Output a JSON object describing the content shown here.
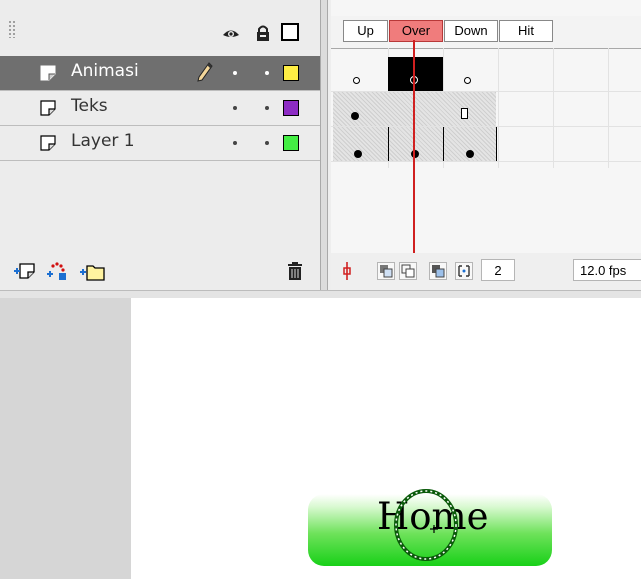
{
  "timeline": {
    "header_icons": [
      "eye-icon",
      "lock-icon",
      "outline-icon"
    ],
    "frame_labels": [
      "Up",
      "Over",
      "Down",
      "Hit"
    ],
    "current_frame_label": "Over",
    "layers": [
      {
        "name": "Animasi",
        "selected": true,
        "color": "#ffee44",
        "pencil": true
      },
      {
        "name": "Teks",
        "selected": false,
        "color": "#8d2cc4"
      },
      {
        "name": "Layer 1",
        "selected": false,
        "color": "#44ee44"
      }
    ],
    "footer_icons": [
      "insert-layer-icon",
      "motion-guide-icon",
      "insert-folder-icon",
      "trash-icon"
    ],
    "current_frame": "2",
    "frame_rate": "12.0 fps",
    "playhead_color": "#d02020"
  },
  "stage": {
    "button_label": "Home",
    "button_color": "#18d018"
  }
}
